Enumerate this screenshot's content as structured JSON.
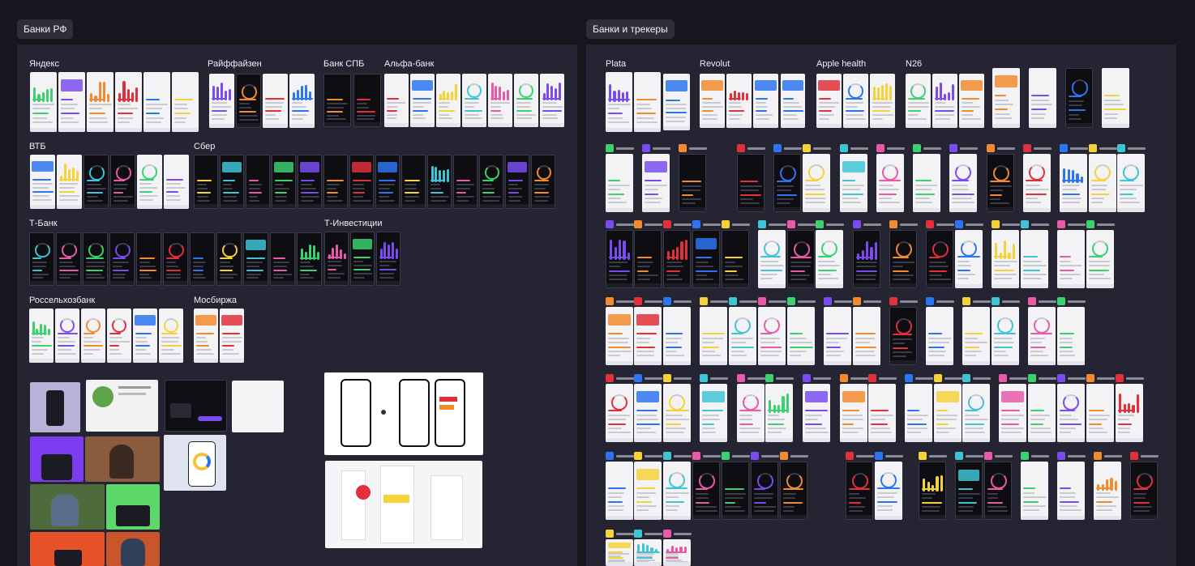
{
  "canvas": {
    "frames": [
      {
        "label": "Банки РФ"
      },
      {
        "label": "Банки и трекеры"
      }
    ]
  },
  "banks_ru": {
    "groups": [
      "Яндекс",
      "Райффайзен",
      "Банк СПБ",
      "Альфа-банк",
      "ВТБ",
      "Сбер",
      "Т-Банк",
      "Т-Инвестиции",
      "Россельхозбанк",
      "Мосбиржа"
    ]
  },
  "banks_trackers": {
    "groups": [
      "Plata",
      "Revolut",
      "Apple health",
      "N26"
    ]
  },
  "colors": {
    "canvas_bg": "#17161f",
    "section_bg": "#252432",
    "label_bg": "#2f2e3a",
    "light_screen": "#f3f3f6",
    "dark_screen": "#0d0d12",
    "accent_green": "#3bd16f",
    "accent_purple": "#7a4cf0",
    "accent_orange": "#f28a2e",
    "accent_red": "#e0303a",
    "accent_blue": "#2d74f0",
    "accent_yellow": "#f6d23a"
  }
}
